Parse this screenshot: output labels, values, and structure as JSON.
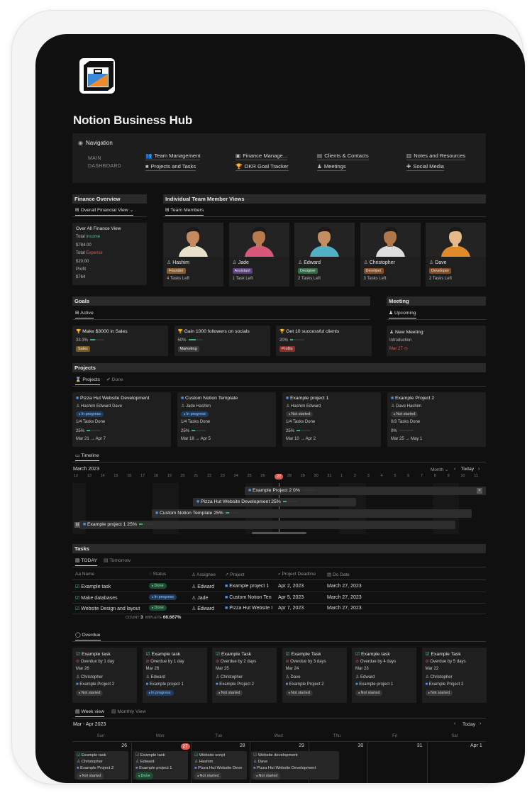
{
  "page_title": "Notion Business Hub",
  "navigation": {
    "title": "Navigation",
    "main_dashboard": "MAIN DASHBOARD",
    "links": [
      "Team Management",
      "Finance Manage...",
      "Clients & Contacts",
      "Notes and Resources",
      "Projects and Tasks",
      "OKR Goal Tracker",
      "Meetings",
      "Social Media"
    ]
  },
  "finance": {
    "header": "Finance Overview",
    "view": "Overall Financial View",
    "card_title": "Over All Finance View",
    "income_prefix": "Total",
    "income_word": "Income",
    "income_value": "$784.00",
    "expense_prefix": "Total",
    "expense_word": "Expense",
    "expense_value": "$20.00",
    "profit_label": "Profit",
    "profit_value": "$764"
  },
  "team": {
    "header": "Individual Team Member Views",
    "view": "Team Members",
    "members": [
      {
        "name": "Hashim",
        "role": "Founder",
        "tasks": "4 Tasks Left",
        "color": "#8a5a2b"
      },
      {
        "name": "Jade",
        "role": "Assistant",
        "tasks": "1 Task Left",
        "color": "#5d3f86"
      },
      {
        "name": "Edward",
        "role": "Designer",
        "tasks": "2 Tasks Left",
        "color": "#2f6b45"
      },
      {
        "name": "Christopher",
        "role": "Develper",
        "tasks": "3 Tasks Left",
        "color": "#8a4a1f"
      },
      {
        "name": "Dave",
        "role": "Developer",
        "tasks": "2 Tasks Left",
        "color": "#8a4a1f"
      }
    ]
  },
  "goals": {
    "header": "Goals",
    "view": "Active",
    "items": [
      {
        "title": "Make $3000 in Sales",
        "pct": "33.3%",
        "fill": 0.333,
        "tag": "Sales",
        "tagcolor": "#7a5a1f"
      },
      {
        "title": "Gain 1000 followers on socials",
        "pct": "50%",
        "fill": 0.5,
        "tag": "Marketing",
        "tagcolor": "#3a3a3a"
      },
      {
        "title": "Get 10 successful clients",
        "pct": "20%",
        "fill": 0.2,
        "tag": "Profits",
        "tagcolor": "#8a2f2a"
      }
    ]
  },
  "meeting": {
    "header": "Meeting",
    "view": "Upcoming",
    "title": "New Meeting",
    "type": "Introduction",
    "date": "Mar 27"
  },
  "projects": {
    "header": "Projects",
    "tabs": [
      "Projects",
      "Done"
    ],
    "items": [
      {
        "title": "Pizza Hut Website Development",
        "people": "Hashim  Edward  Dave",
        "status": "In progress",
        "status_class": "prog",
        "tasks": "1/4 Tasks Done",
        "pct": "25%",
        "fill": 0.25,
        "dates": "Mar 21 → Apr 7"
      },
      {
        "title": "Custom Notion Template",
        "people": "Jade  Hashim",
        "status": "In progress",
        "status_class": "prog",
        "tasks": "1/4 Tasks Done",
        "pct": "25%",
        "fill": 0.25,
        "dates": "Mar 18 → Apr 5"
      },
      {
        "title": "Example project 1",
        "people": "Hashim  Edward",
        "status": "Not started",
        "status_class": "not",
        "tasks": "1/4 Tasks Done",
        "pct": "25%",
        "fill": 0.25,
        "dates": "Mar 10 → Apr 2"
      },
      {
        "title": "Example Project 2",
        "people": "Dave  Hashim",
        "status": "Not started",
        "status_class": "not",
        "tasks": "0/3 Tasks Done",
        "pct": "0%",
        "fill": 0,
        "dates": "Mar 25 → May 1"
      }
    ]
  },
  "timeline": {
    "tab": "Timeline",
    "month": "March 2023",
    "scale": "Month",
    "today_btn": "Today",
    "days": [
      "12",
      "13",
      "14",
      "15",
      "16",
      "17",
      "18",
      "19",
      "20",
      "21",
      "22",
      "23",
      "24",
      "25",
      "26",
      "27",
      "28",
      "29",
      "30",
      "31",
      "1",
      "2",
      "3",
      "4",
      "5",
      "6",
      "7",
      "8",
      "9",
      "10",
      "11"
    ],
    "today_day": "27",
    "bars": [
      {
        "title": "Example Project 2",
        "pct": "0%",
        "fill": 0
      },
      {
        "title": "Pizza Hut Website Development",
        "pct": "25%",
        "fill": 0.25
      },
      {
        "title": "Custom Notion Template",
        "pct": "25%",
        "fill": 0.25
      },
      {
        "title": "Example project 1",
        "pct": "25%",
        "fill": 0.25
      }
    ]
  },
  "tasks": {
    "header": "Tasks",
    "tabs": [
      "TODAY",
      "Tomorrow"
    ],
    "columns": [
      "Name",
      "Status",
      "Assignee",
      "Project",
      "Project Deadline",
      "Do Date"
    ],
    "rows": [
      {
        "name": "Example task",
        "status": "Done",
        "status_class": "done",
        "assignee": "Edward",
        "project": "Example project 1",
        "deadline": "Apr 2, 2023",
        "do": "March 27, 2023"
      },
      {
        "name": "Make databases",
        "status": "In progress",
        "status_class": "prog",
        "assignee": "Jade",
        "project": "Custom Notion Ten",
        "deadline": "Apr 5, 2023",
        "do": "March 27, 2023"
      },
      {
        "name": "Website Design and layout",
        "status": "Done",
        "status_class": "done",
        "assignee": "Edward",
        "project": "Pizza Hut Website I",
        "deadline": "Apr 7, 2023",
        "do": "March 27, 2023"
      }
    ],
    "count_label": "COUNT",
    "count_value": "3",
    "complete_label": "IMPLETE",
    "complete_value": "66.667%"
  },
  "overdue": {
    "tab": "Overdue",
    "items": [
      {
        "title": "Example task",
        "overdue": "Overdue by 1 day",
        "date": "Mar 26",
        "person": "Christopher",
        "project": "Example Project 2",
        "status": "Not started",
        "status_class": "not"
      },
      {
        "title": "Example task",
        "overdue": "Overdue by 1 day",
        "date": "Mar 26",
        "person": "Edward",
        "project": "Example project 1",
        "status": "In progress",
        "status_class": "prog"
      },
      {
        "title": "Example Task",
        "overdue": "Overdue by 2 days",
        "date": "Mar 25",
        "person": "Christopher",
        "project": "Example Project 2",
        "status": "Not started",
        "status_class": "not"
      },
      {
        "title": "Example Task",
        "overdue": "Overdue by 3 days",
        "date": "Mar 24",
        "person": "Dave",
        "project": "Example Project 2",
        "status": "Not started",
        "status_class": "not"
      },
      {
        "title": "Example task",
        "overdue": "Overdue by 4 days",
        "date": "Mar 23",
        "person": "Edward",
        "project": "Example project 1",
        "status": "Not started",
        "status_class": "not"
      },
      {
        "title": "Example Task",
        "overdue": "Overdue by 5 days",
        "date": "Mar 22",
        "person": "Christopher",
        "project": "Example Project 2",
        "status": "Not started",
        "status_class": "not"
      }
    ]
  },
  "calendar": {
    "tabs": [
      "Week view",
      "Monthly View"
    ],
    "range": "Mar - Apr 2023",
    "today_btn": "Today",
    "weekdays": [
      "Sun",
      "Mon",
      "Tue",
      "Wed",
      "Thu",
      "Fri",
      "Sat"
    ],
    "dates": [
      "26",
      "27",
      "28",
      "29",
      "30",
      "31",
      "Apr 1"
    ],
    "events": [
      {
        "title": "Example task",
        "person": "Christopher",
        "project": "Example Project 2",
        "status": "Not started",
        "status_class": "not"
      },
      {
        "title": "Example task",
        "person": "Edward",
        "project": "Example project 1",
        "status": "Done",
        "status_class": "done"
      },
      {
        "title": "Website script",
        "person": "Hashim",
        "project": "Pizza Hut Website Deve",
        "status": "Not started",
        "status_class": "not"
      },
      {
        "title": "Website development",
        "person": "Dave",
        "project": "Pizza Hut Website Development",
        "status": "Not started",
        "status_class": "not"
      }
    ]
  }
}
